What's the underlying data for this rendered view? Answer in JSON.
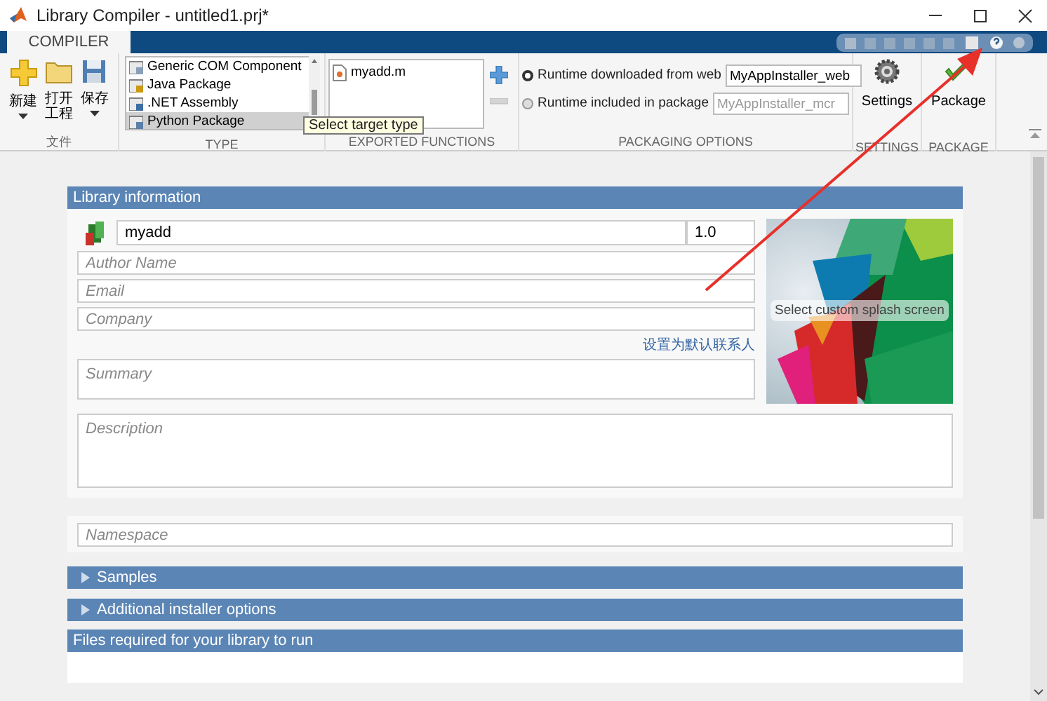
{
  "window": {
    "title": "Library Compiler - untitled1.prj*"
  },
  "ribbon_tabs": [
    {
      "label": "COMPILER",
      "selected": true
    }
  ],
  "file_section": {
    "label": "文件",
    "buttons": [
      {
        "label": "新建",
        "kind": "new",
        "dropdown": true
      },
      {
        "label": "打开工程",
        "kind": "open",
        "dropdown": false
      },
      {
        "label": "保存",
        "kind": "save",
        "dropdown": true
      }
    ]
  },
  "type_section": {
    "label": "TYPE",
    "tooltip": "Select target type",
    "items": [
      {
        "label": "Generic COM Component",
        "selected": false
      },
      {
        "label": "Java Package",
        "selected": false
      },
      {
        "label": ".NET Assembly",
        "selected": false
      },
      {
        "label": "Python Package",
        "selected": true
      }
    ]
  },
  "exported_functions": {
    "label": "EXPORTED FUNCTIONS",
    "files": [
      "myadd.m"
    ]
  },
  "packaging_options": {
    "label": "PACKAGING OPTIONS",
    "options": [
      {
        "label": "Runtime downloaded from web",
        "value": "MyAppInstaller_web",
        "selected": true
      },
      {
        "label": "Runtime included in package",
        "value": "MyAppInstaller_mcr",
        "selected": false
      }
    ]
  },
  "settings": {
    "button": "Settings",
    "label": "SETTINGS"
  },
  "package": {
    "button": "Package",
    "label": "PACKAGE"
  },
  "library_info": {
    "header": "Library information",
    "name": "myadd",
    "version": "1.0",
    "author": {
      "placeholder": "Author Name"
    },
    "email": {
      "placeholder": "Email"
    },
    "company": {
      "placeholder": "Company"
    },
    "contact_link": "设置为默认联系人",
    "summary": {
      "placeholder": "Summary"
    },
    "description": {
      "placeholder": "Description"
    },
    "splash_label": "Select custom splash screen"
  },
  "namespace": {
    "placeholder": "Namespace"
  },
  "sections": [
    {
      "title": "Samples",
      "kind": "collapsible",
      "expanded": false
    },
    {
      "title": "Additional installer options",
      "kind": "collapsible",
      "expanded": false
    },
    {
      "title": "Files required for your library to run",
      "kind": "panel"
    }
  ]
}
